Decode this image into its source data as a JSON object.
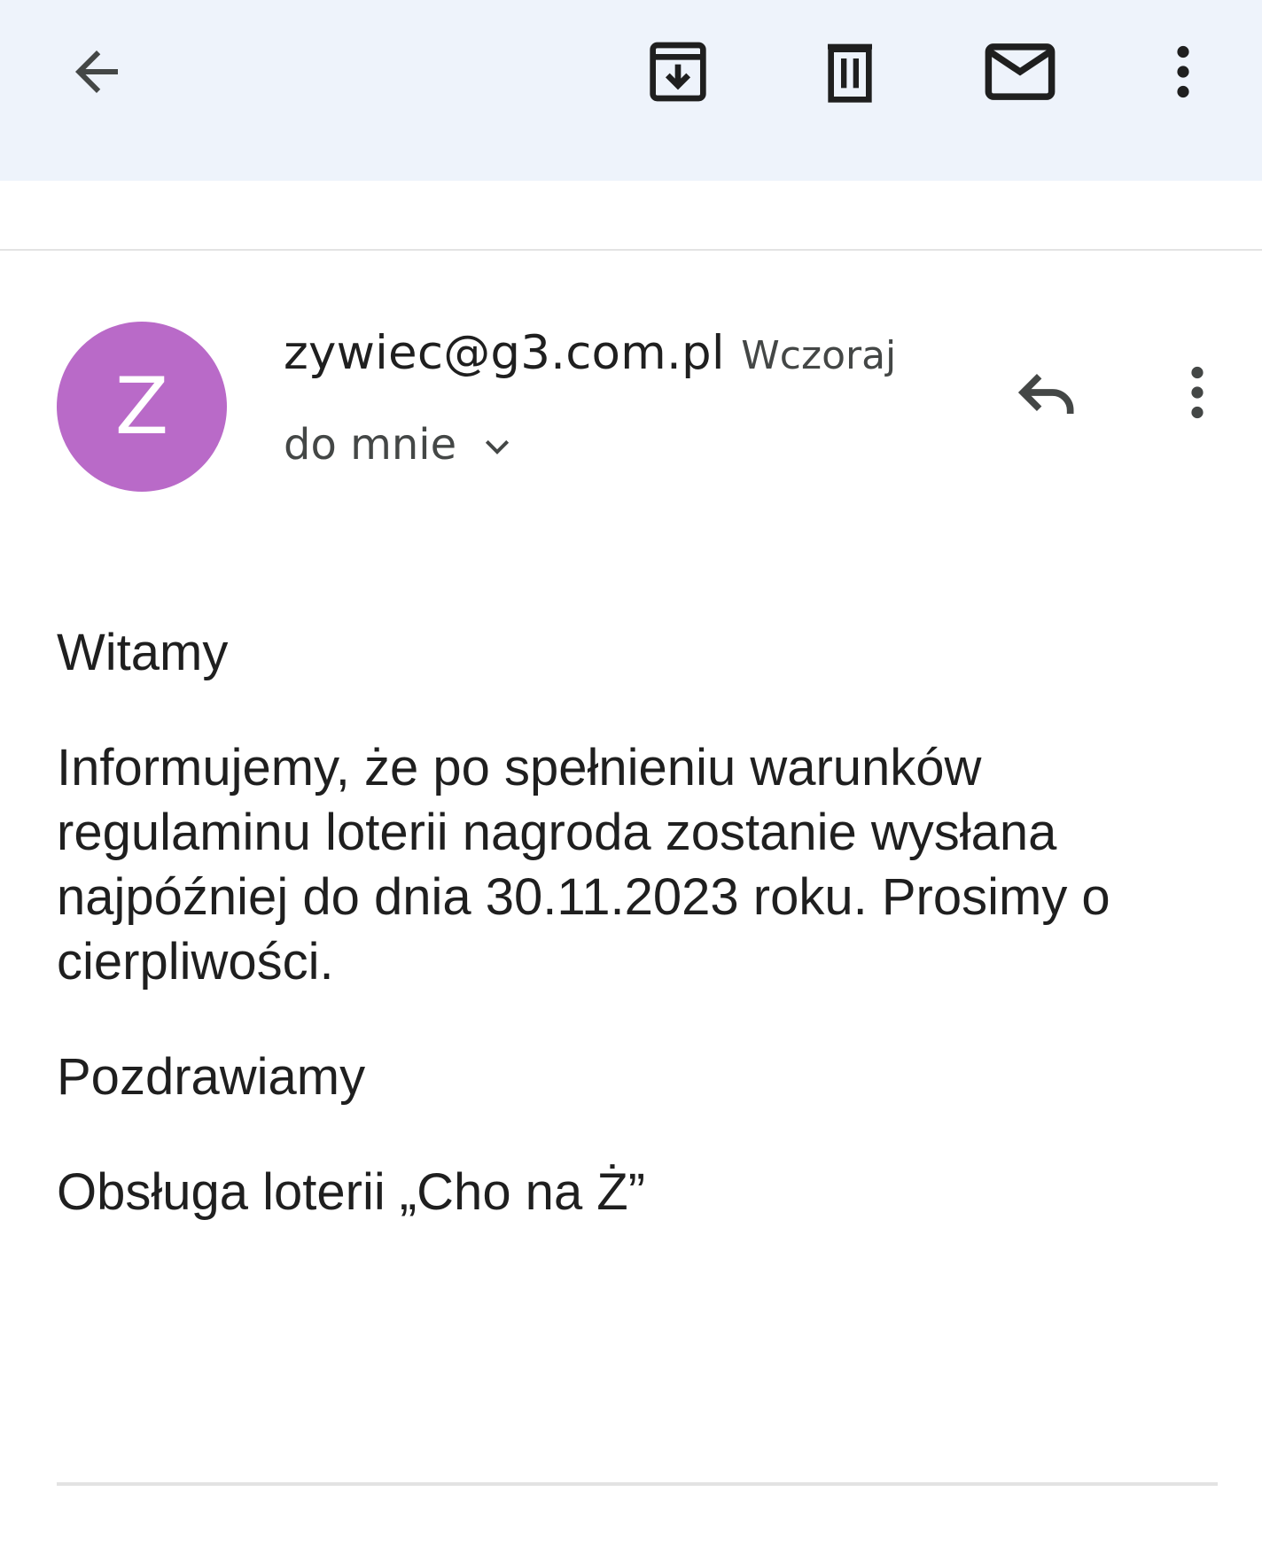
{
  "toolbar": {
    "back_icon": "arrow-back-icon",
    "archive_icon": "archive-icon",
    "delete_icon": "trash-icon",
    "mark_unread_icon": "mail-icon",
    "more_icon": "more-vert-icon"
  },
  "message": {
    "avatar_letter": "Z",
    "avatar_color": "#b96ac8",
    "sender": "zywiec@g3.com.pl",
    "date": "Wczoraj",
    "recipient": "do mnie",
    "reply_icon": "reply-icon",
    "more_icon": "more-vert-icon",
    "body": {
      "greeting": "Witamy",
      "paragraph": "Informujemy, że po spełnieniu warunków regulaminu loterii nagroda zostanie wysłana najpóźniej do dnia 30.11.2023 roku. Prosimy o cierpliwości.",
      "closing": "Pozdrawiamy",
      "signature": "Obsługa loterii „Cho na Ż”"
    }
  },
  "colors": {
    "topbar_bg": "#eef3fb",
    "icon": "#1f1f1f",
    "secondary_text": "#444746",
    "divider": "#e3e3e3"
  }
}
